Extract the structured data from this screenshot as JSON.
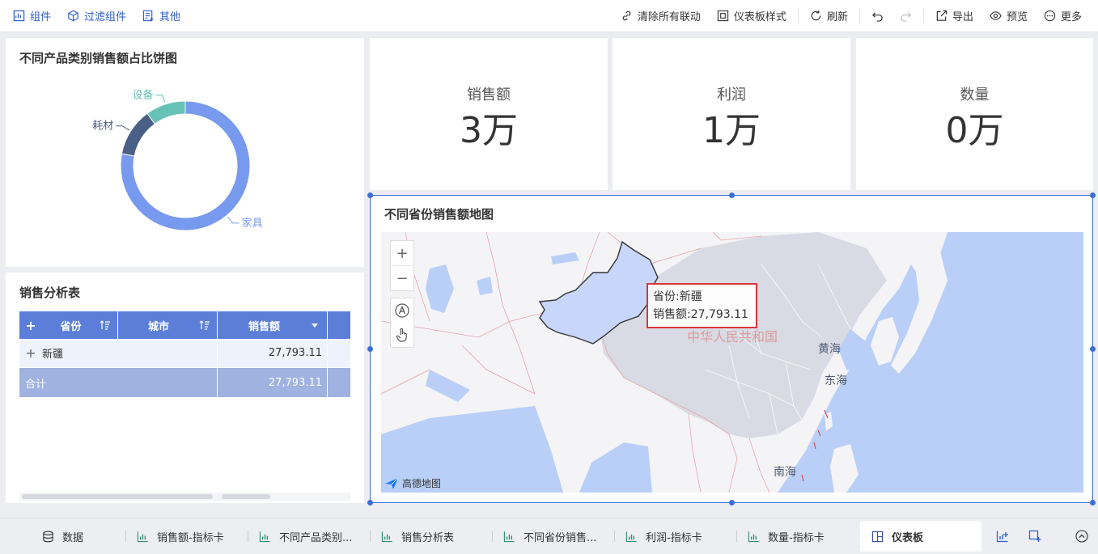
{
  "toolbar": {
    "left": [
      {
        "label": "组件",
        "icon": "add-component-icon"
      },
      {
        "label": "过滤组件",
        "icon": "filter-cube-icon"
      },
      {
        "label": "其他",
        "icon": "other-icon"
      }
    ],
    "clear_links": "清除所有联动",
    "dashboard_style": "仪表板样式",
    "refresh": "刷新",
    "export": "导出",
    "preview": "预览",
    "more": "更多"
  },
  "pie_panel": {
    "title": "不同产品类别销售额占比饼图"
  },
  "chart_data": {
    "type": "pie",
    "title": "不同产品类别销售额占比饼图",
    "categories": [
      "家具",
      "耗材",
      "设备"
    ],
    "values": [
      78,
      12,
      10
    ],
    "colors": [
      "#7799ee",
      "#4a5f86",
      "#66c2b6"
    ]
  },
  "kpis": [
    {
      "label": "销售额",
      "value": "3万"
    },
    {
      "label": "利润",
      "value": "1万"
    },
    {
      "label": "数量",
      "value": "0万"
    }
  ],
  "table": {
    "title": "销售分析表",
    "headers": [
      "省份",
      "城市",
      "销售额"
    ],
    "rows": [
      {
        "province": "新疆",
        "sales": "27,793.11"
      }
    ],
    "total_label": "合计",
    "total_value": "27,793.11"
  },
  "map": {
    "title": "不同省份销售额地图",
    "tooltip": {
      "province": "省份:新疆",
      "sales": "销售额:27,793.11"
    },
    "country_label": "中华人民共和国",
    "seas": [
      "黄海",
      "东海",
      "南海"
    ],
    "attribution": "高德地图",
    "zoom_in": "+",
    "zoom_out": "−"
  },
  "tabs": [
    {
      "label": "数据",
      "icon": "database-icon"
    },
    {
      "label": "销售额-指标卡",
      "icon": "bar-chart-icon"
    },
    {
      "label": "不同产品类别...",
      "icon": "bar-chart-icon"
    },
    {
      "label": "销售分析表",
      "icon": "bar-chart-icon"
    },
    {
      "label": "不同省份销售...",
      "icon": "bar-chart-icon"
    },
    {
      "label": "利润-指标卡",
      "icon": "bar-chart-icon"
    },
    {
      "label": "数量-指标卡",
      "icon": "bar-chart-icon"
    },
    {
      "label": "仪表板",
      "icon": "dashboard-icon"
    }
  ]
}
